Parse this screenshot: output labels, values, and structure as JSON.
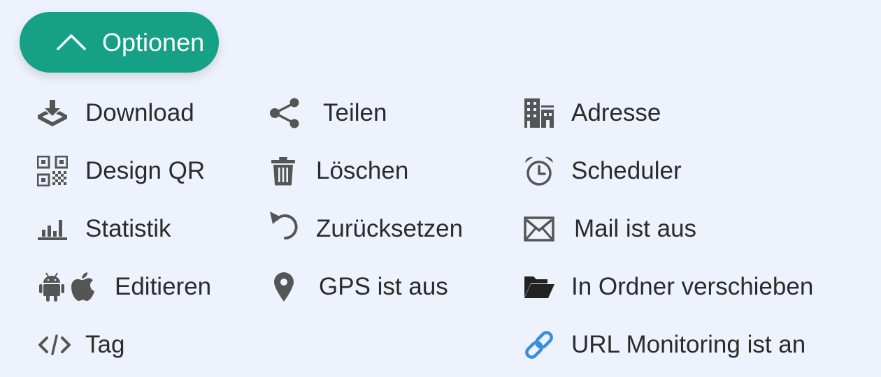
{
  "toggle": {
    "label": "Optionen",
    "icon": "chevron-up-icon",
    "color": "#16a085",
    "expanded": true
  },
  "actions": {
    "download": {
      "label": "Download",
      "icon": "tray-download-icon"
    },
    "share": {
      "label": "Teilen",
      "icon": "share-icon"
    },
    "address": {
      "label": "Adresse",
      "icon": "buildings-icon"
    },
    "design_qr": {
      "label": "Design QR",
      "icon": "qr-code-icon"
    },
    "delete": {
      "label": "Löschen",
      "icon": "trash-icon"
    },
    "scheduler": {
      "label": "Scheduler",
      "icon": "alarm-clock-icon"
    },
    "statistics": {
      "label": "Statistik",
      "icon": "bar-chart-icon"
    },
    "reset": {
      "label": "Zurücksetzen",
      "icon": "undo-icon"
    },
    "mail": {
      "label": "Mail ist aus",
      "icon": "envelope-icon"
    },
    "edit": {
      "label": "Editieren",
      "icon": "android-apple-icon"
    },
    "gps": {
      "label": "GPS ist aus",
      "icon": "map-pin-icon"
    },
    "move_folder": {
      "label": "In Ordner verschieben",
      "icon": "folder-open-icon"
    },
    "tag": {
      "label": "Tag",
      "icon": "code-icon"
    },
    "url_monitoring": {
      "label": "URL Monitoring ist an",
      "icon": "link-icon",
      "icon_color": "#3a8fdc"
    }
  }
}
